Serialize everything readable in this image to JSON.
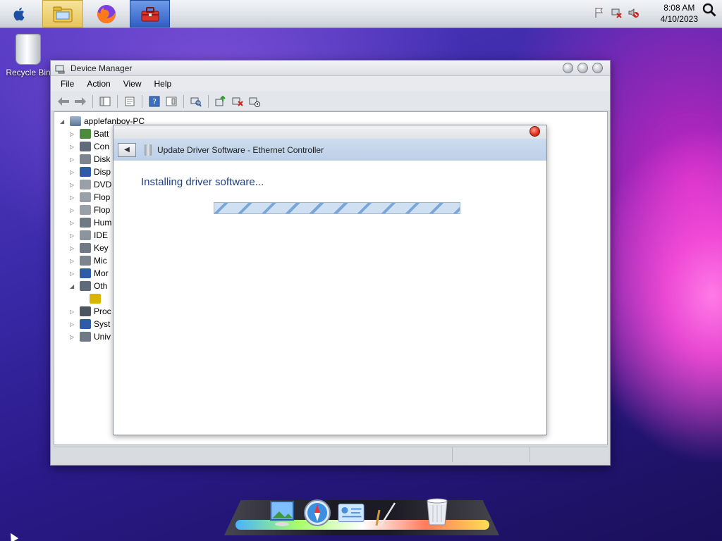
{
  "taskbar": {
    "clock_time": "8:08 AM",
    "clock_date": "4/10/2023"
  },
  "desktop": {
    "recycle_bin_label": "Recycle Bin"
  },
  "device_manager": {
    "title": "Device Manager",
    "menu": [
      "File",
      "Action",
      "View",
      "Help"
    ],
    "tree_root": "applefanboy-PC",
    "tree_items": [
      {
        "label": "Batt",
        "expander": "▷"
      },
      {
        "label": "Con",
        "expander": "▷"
      },
      {
        "label": "Disk",
        "expander": "▷"
      },
      {
        "label": "Disp",
        "expander": "▷"
      },
      {
        "label": "DVD",
        "expander": "▷"
      },
      {
        "label": "Flop",
        "expander": "▷"
      },
      {
        "label": "Flop",
        "expander": "▷"
      },
      {
        "label": "Hum",
        "expander": "▷"
      },
      {
        "label": "IDE",
        "expander": "▷"
      },
      {
        "label": "Key",
        "expander": "▷"
      },
      {
        "label": "Mic",
        "expander": "▷"
      },
      {
        "label": "Mor",
        "expander": "▷"
      },
      {
        "label": "Oth",
        "expander": "◢"
      },
      {
        "label": "",
        "expander": ""
      },
      {
        "label": "Proc",
        "expander": "▷"
      },
      {
        "label": "Syst",
        "expander": "▷"
      },
      {
        "label": "Univ",
        "expander": "▷"
      }
    ]
  },
  "dialog": {
    "header_title": "Update Driver Software - Ethernet Controller",
    "message": "Installing driver software..."
  },
  "colors": {
    "dialog_header": "#bcd0e8",
    "message_text": "#1e3f86",
    "close_button": "#e0321f"
  }
}
